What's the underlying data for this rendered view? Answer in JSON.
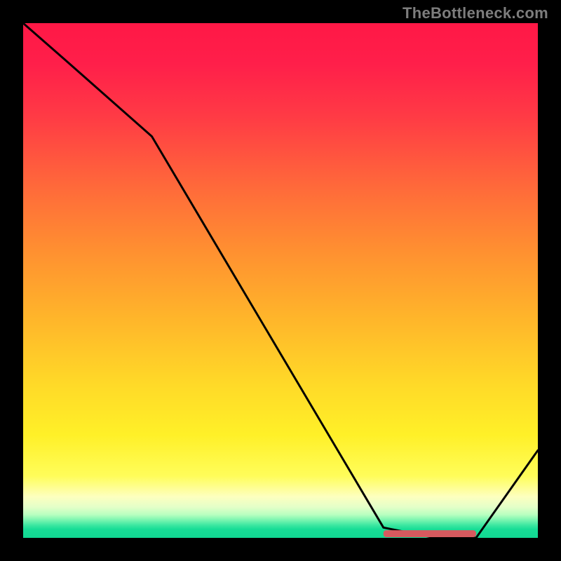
{
  "attribution": "TheBottleneck.com",
  "chart_data": {
    "type": "line",
    "title": "",
    "xlabel": "",
    "ylabel": "",
    "xlim": [
      0,
      100
    ],
    "ylim": [
      0,
      100
    ],
    "series": [
      {
        "name": "bottleneck-curve",
        "x": [
          0,
          8,
          25,
          70,
          80,
          88,
          100
        ],
        "values": [
          100,
          93,
          78,
          2,
          0,
          0,
          17
        ]
      }
    ],
    "marker": {
      "name": "recommended-range",
      "x_start": 70,
      "x_end": 88,
      "y": 0,
      "color": "#d65a5f"
    },
    "gradient_stops": [
      {
        "pos": 0.0,
        "color": "#ff1846"
      },
      {
        "pos": 0.45,
        "color": "#ff9230"
      },
      {
        "pos": 0.8,
        "color": "#fff028"
      },
      {
        "pos": 0.92,
        "color": "#fdffbf"
      },
      {
        "pos": 1.0,
        "color": "#11d892"
      }
    ]
  }
}
